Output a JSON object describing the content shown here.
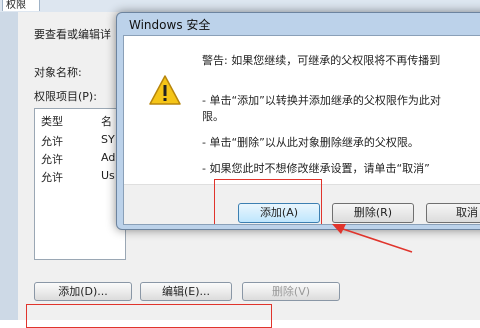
{
  "background_window": {
    "tab_label": "权限",
    "description": "要查看或编辑详",
    "object_name_label": "对象名称:",
    "entries_label": "权限项目(P):",
    "list": {
      "columns": [
        "类型",
        "名"
      ],
      "rows": [
        [
          "允许",
          "SY"
        ],
        [
          "允许",
          "Ad"
        ],
        [
          "允许",
          "Us"
        ]
      ]
    },
    "buttons": {
      "add": "添加(D)...",
      "edit": "编辑(E)...",
      "remove": "删除(V)"
    }
  },
  "dialog": {
    "title": "Windows 安全",
    "icon": "warning-icon",
    "message_warning": "警告: 如果您继续，可继承的父权限将不再传播到",
    "message_add_1": "- 单击“添加”以转换并添加继承的父权限作为此对",
    "message_add_2": "限。",
    "message_remove": "- 单击“删除”以从此对象删除继承的父权限。",
    "message_cancel": "- 如果您此时不想修改继承设置，请单击“取消”",
    "buttons": {
      "add": "添加(A)",
      "remove": "删除(R)",
      "cancel": "取消"
    }
  },
  "colors": {
    "annotation_red": "#e0342c",
    "dialog_frame": "#bcd2ea",
    "warning_yellow": "#f5c518"
  }
}
